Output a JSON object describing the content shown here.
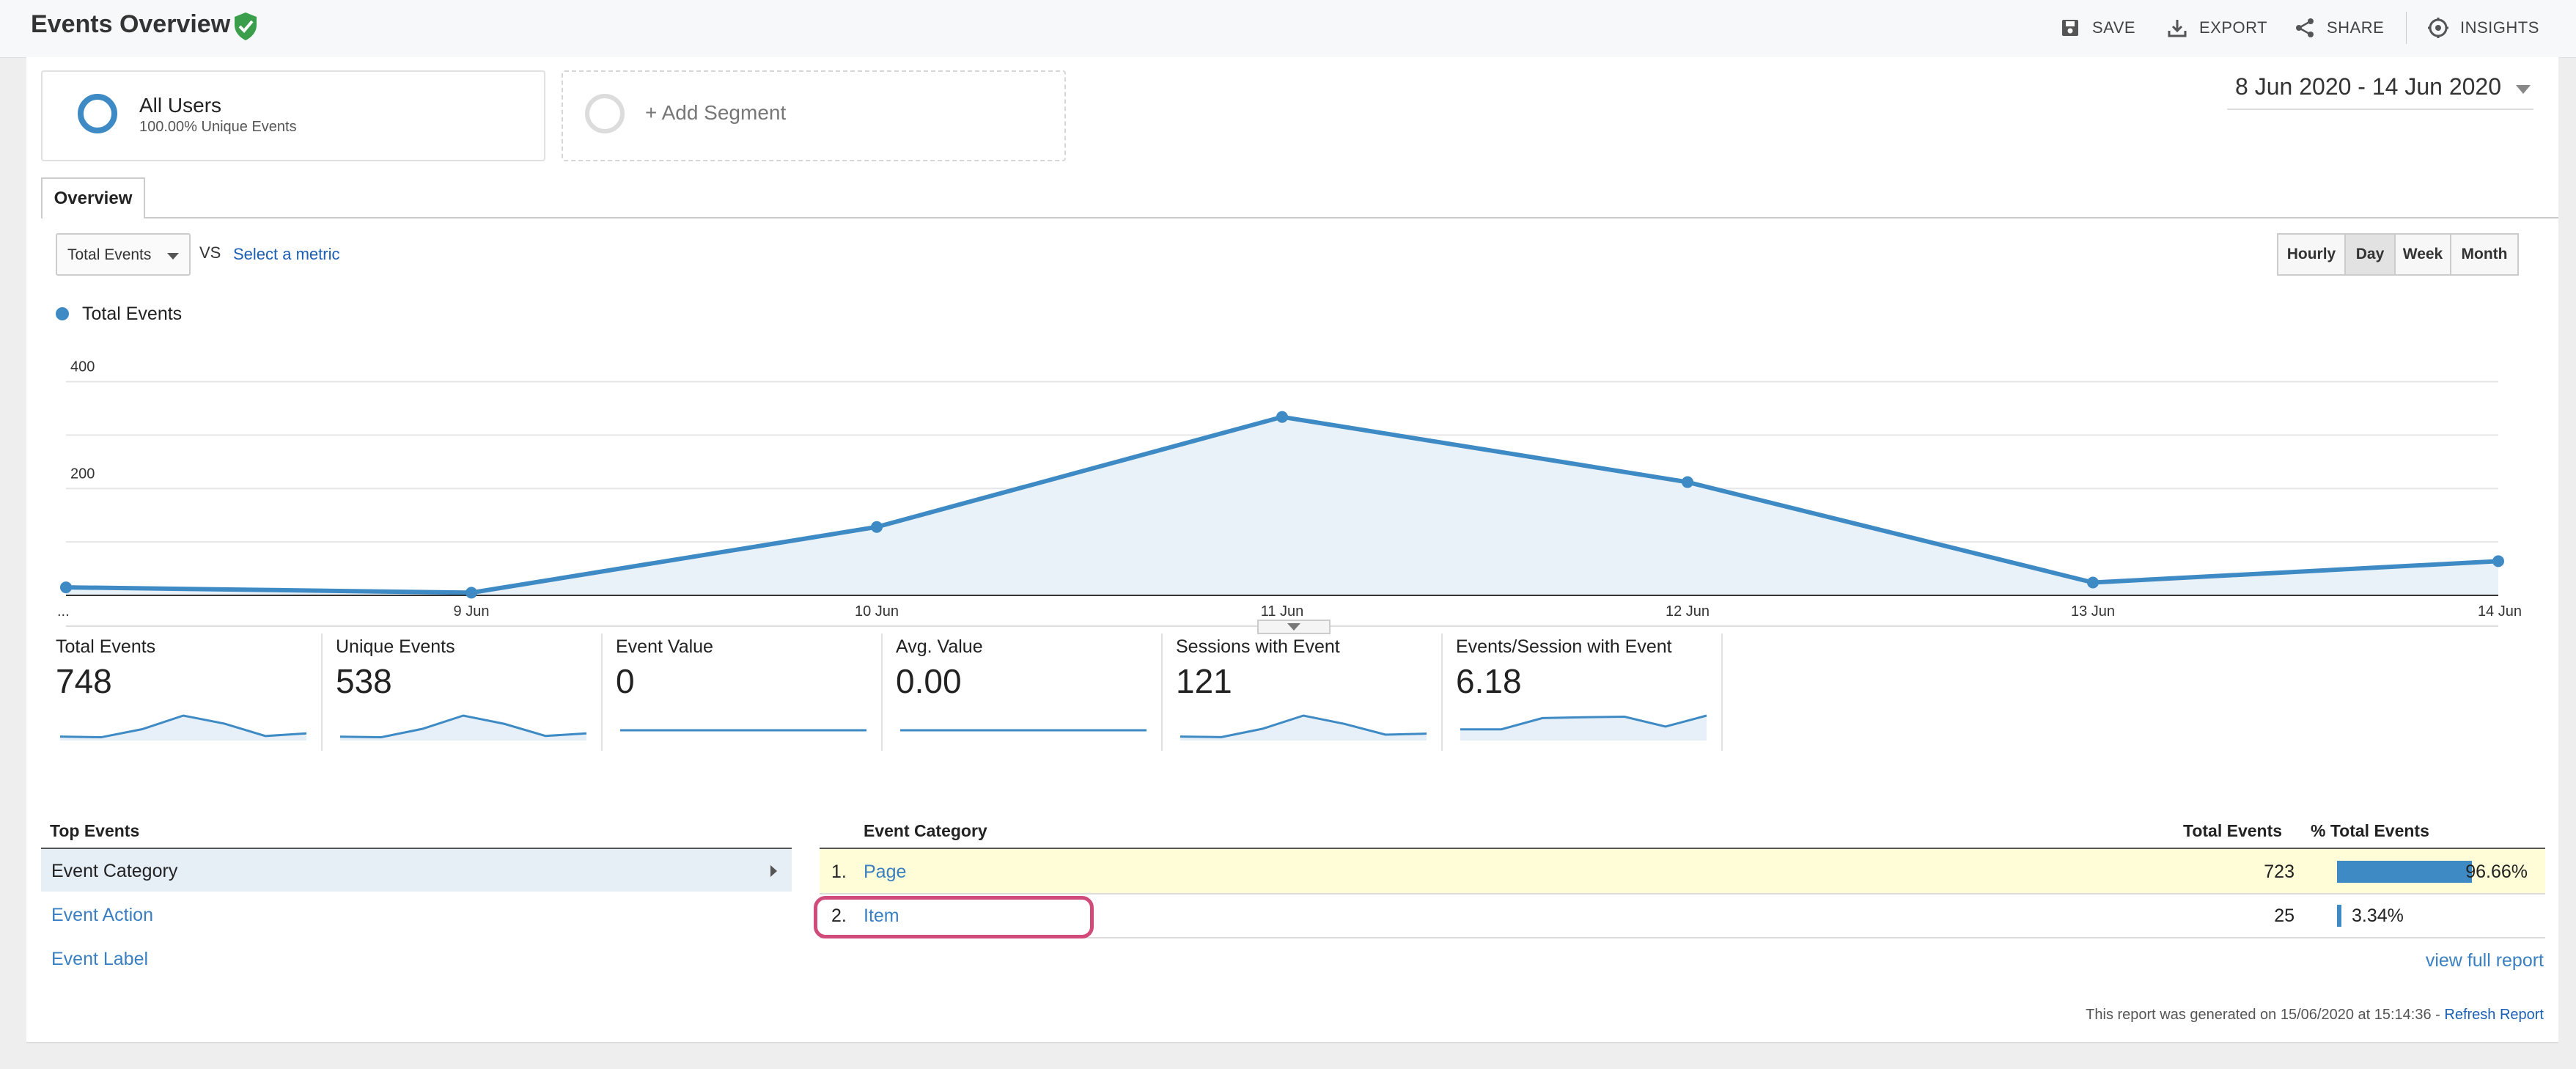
{
  "header": {
    "title": "Events Overview",
    "actions": [
      {
        "label": "SAVE",
        "icon": "save-icon"
      },
      {
        "label": "EXPORT",
        "icon": "export-icon"
      },
      {
        "label": "SHARE",
        "icon": "share-icon"
      },
      {
        "label": "INSIGHTS",
        "icon": "insights-icon"
      }
    ]
  },
  "segments": {
    "primary": {
      "title": "All Users",
      "subtitle": "100.00% Unique Events"
    },
    "add_label": "+ Add Segment"
  },
  "date_range": "8 Jun 2020 - 14 Jun 2020",
  "tabs": [
    {
      "label": "Overview"
    }
  ],
  "metric_selector": {
    "selected": "Total Events",
    "vs_label": "VS",
    "select_metric_label": "Select a metric"
  },
  "granularity": {
    "options": [
      "Hourly",
      "Day",
      "Week",
      "Month"
    ],
    "selected": "Day"
  },
  "colors": {
    "accent": "#3e8ac4",
    "link": "#3a7fc1",
    "highlight_row": "#fefdd8",
    "annotation": "#d04a7a"
  },
  "chart_data": {
    "type": "area",
    "series": [
      {
        "name": "Total Events",
        "values": [
          15,
          5,
          128,
          334,
          212,
          24,
          64
        ]
      }
    ],
    "categories": [
      "...",
      "9 Jun",
      "10 Jun",
      "11 Jun",
      "12 Jun",
      "13 Jun",
      "14 Jun"
    ],
    "yticks": [
      200,
      400
    ],
    "ylim": [
      0,
      420
    ],
    "grid": true,
    "legend": "top-left"
  },
  "scorecards": [
    {
      "title": "Total Events",
      "value": "748",
      "spark": [
        15,
        5,
        128,
        334,
        212,
        24,
        64
      ]
    },
    {
      "title": "Unique Events",
      "value": "538",
      "spark": [
        10,
        4,
        95,
        240,
        150,
        18,
        46
      ]
    },
    {
      "title": "Event Value",
      "value": "0",
      "spark": [
        0,
        0,
        0,
        0,
        0,
        0,
        0
      ]
    },
    {
      "title": "Avg. Value",
      "value": "0.00",
      "spark": [
        0,
        0,
        0,
        0,
        0,
        0,
        0
      ]
    },
    {
      "title": "Sessions with Event",
      "value": "121",
      "spark": [
        2,
        1,
        18,
        45,
        28,
        6,
        8
      ]
    },
    {
      "title": "Events/Session with Event",
      "value": "6.18",
      "spark": [
        3.0,
        3.0,
        7.1,
        7.4,
        7.6,
        4.0,
        8.0
      ]
    }
  ],
  "top_events": {
    "title": "Top Events",
    "items": [
      "Event Category",
      "Event Action",
      "Event Label"
    ],
    "selected": "Event Category"
  },
  "table": {
    "headers": {
      "category": "Event Category",
      "total": "Total Events",
      "pct": "% Total Events"
    },
    "rows": [
      {
        "num": "1.",
        "category": "Page",
        "total": "723",
        "pct": "96.66%",
        "pct_value": 96.66
      },
      {
        "num": "2.",
        "category": "Item",
        "total": "25",
        "pct": "3.34%",
        "pct_value": 3.34
      }
    ]
  },
  "view_full_report": "view full report",
  "report_note": {
    "text": "This report was generated on 15/06/2020 at 15:14:36 - ",
    "link": "Refresh Report"
  }
}
